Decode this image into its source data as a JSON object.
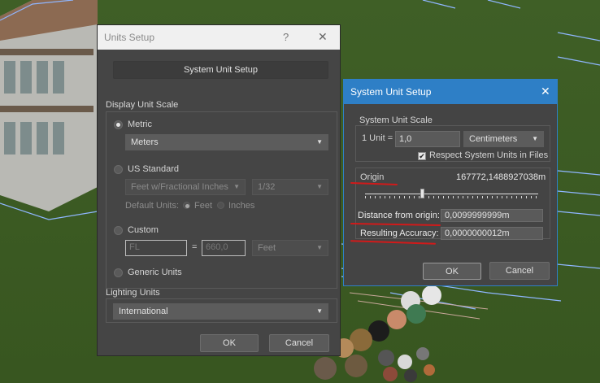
{
  "units_setup": {
    "title": "Units Setup",
    "help_label": "?",
    "close_label": "✕",
    "system_unit_setup_button": "System Unit Setup",
    "display_unit_scale_label": "Display Unit Scale",
    "metric_label": "Metric",
    "metric_value": "Meters",
    "us_standard_label": "US Standard",
    "us_value": "Feet w/Fractional Inches",
    "us_fraction": "1/32",
    "default_units_label": "Default Units:",
    "feet_label": "Feet",
    "inches_label": "Inches",
    "custom_label": "Custom",
    "custom_name": "FL",
    "equals": "=",
    "custom_amount": "660,0",
    "custom_unit": "Feet",
    "generic_units_label": "Generic Units",
    "lighting_units_label": "Lighting Units",
    "lighting_value": "International",
    "ok_label": "OK",
    "cancel_label": "Cancel",
    "selected_scale": "Metric"
  },
  "system_unit_setup": {
    "title": "System Unit Setup",
    "close_label": "✕",
    "scale_group_label": "System Unit Scale",
    "one_unit_label": "1 Unit =",
    "unit_value": "1,0",
    "unit_type": "Centimeters",
    "respect_label": "Respect System Units in Files",
    "respect_checked": true,
    "origin_label": "Origin",
    "origin_value": "167772,1488927038m",
    "distance_label": "Distance from origin:",
    "distance_value": "0,0099999999m",
    "accuracy_label": "Resulting Accuracy:",
    "accuracy_value": "0,0000000012m",
    "ok_label": "OK",
    "cancel_label": "Cancel"
  },
  "icons": {
    "dropdown": "chevron-down-icon",
    "check": "✔"
  },
  "colors": {
    "dialog_bg": "#444444",
    "title_active": "#2e7fc6",
    "annotation": "#d11a1a",
    "viewport_grass": "#3f5f26"
  }
}
